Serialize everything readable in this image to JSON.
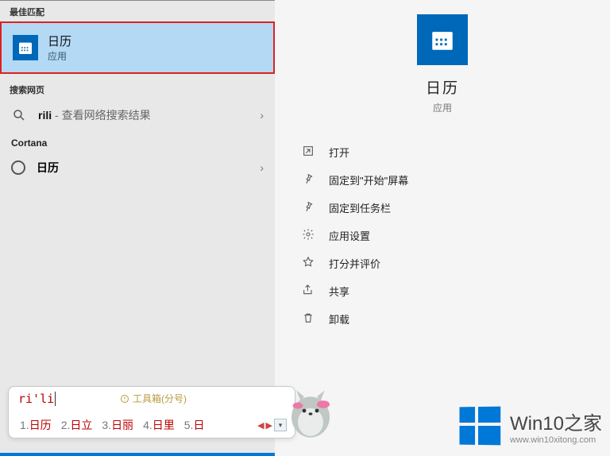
{
  "left": {
    "best_match_header": "最佳匹配",
    "best_match": {
      "title": "日历",
      "subtitle": "应用"
    },
    "search_web_header": "搜索网页",
    "web_query": "rili",
    "web_suffix": " - 查看网络搜索结果",
    "cortana_header": "Cortana",
    "cortana_item": "日历"
  },
  "right": {
    "title": "日历",
    "subtitle": "应用",
    "actions": [
      {
        "icon": "open",
        "label": "打开"
      },
      {
        "icon": "pin-start",
        "label": "固定到\"开始\"屏幕"
      },
      {
        "icon": "pin-task",
        "label": "固定到任务栏"
      },
      {
        "icon": "settings",
        "label": "应用设置"
      },
      {
        "icon": "rate",
        "label": "打分并评价"
      },
      {
        "icon": "share",
        "label": "共享"
      },
      {
        "icon": "uninstall",
        "label": "卸载"
      }
    ]
  },
  "ime": {
    "input": "ri'li",
    "tool_label": "工具箱(分号)",
    "candidates": [
      {
        "n": "1.",
        "t": "日历"
      },
      {
        "n": "2.",
        "t": "日立"
      },
      {
        "n": "3.",
        "t": "日丽"
      },
      {
        "n": "4.",
        "t": "日里"
      },
      {
        "n": "5.",
        "t": "日"
      }
    ],
    "arrow_left": "◀",
    "arrow_right": "▶",
    "dropdown": "▾"
  },
  "watermark": {
    "title": "Win10之家",
    "url": "www.win10xitong.com"
  }
}
